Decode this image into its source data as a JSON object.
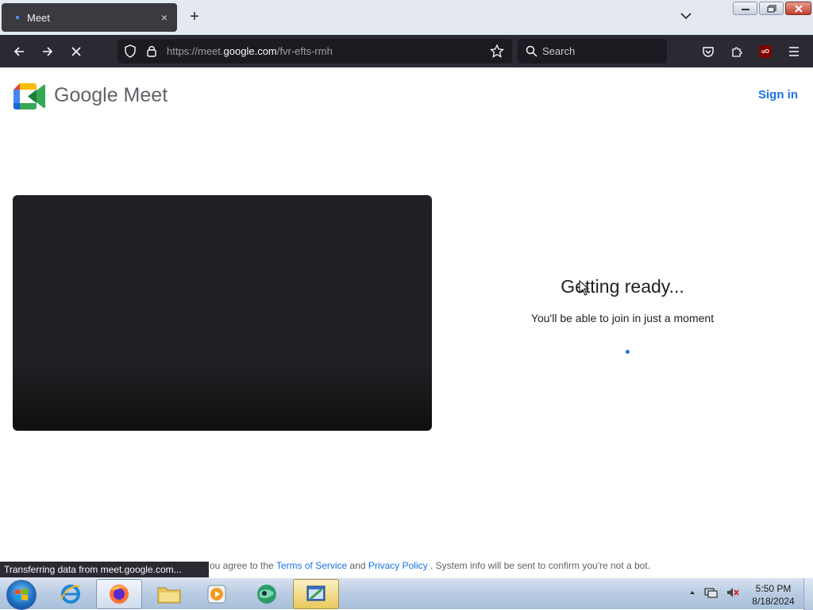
{
  "browser": {
    "tab": {
      "title": "Meet",
      "close_glyph": "×"
    },
    "new_tab_glyph": "+",
    "url": {
      "prefix": "https://meet.",
      "host": "google.com",
      "path": "/fvr-efts-rmh"
    },
    "search_placeholder": "Search",
    "ublock_label": "uO"
  },
  "page": {
    "brand": "Google Meet",
    "sign_in": "Sign in",
    "getting_ready": "Getting ready...",
    "ready_subtitle": "You'll be able to join in just a moment",
    "footer": {
      "prefix": "ou agree to the ",
      "terms": "Terms of Service",
      "and": " and ",
      "privacy": "Privacy Policy",
      "suffix": " . System info will be sent to confirm you're not a bot."
    },
    "status_text": "Transferring data from meet.google.com..."
  },
  "taskbar": {
    "time": "5:50 PM",
    "date": "8/18/2024"
  },
  "colors": {
    "accent_blue": "#1a73e8",
    "browser_dark": "#2b2a33",
    "video_bg": "#202124"
  }
}
